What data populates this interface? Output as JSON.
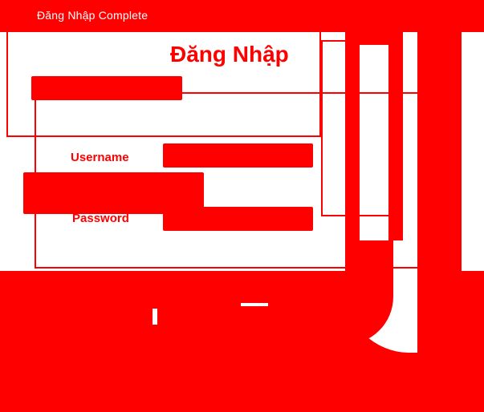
{
  "window": {
    "title": "Đăng Nhập Complete"
  },
  "form": {
    "heading": "Đăng Nhập",
    "username_label": "Username",
    "username_value": "",
    "password_label": "Password",
    "password_value": ""
  },
  "colors": {
    "accent": "#ff0000",
    "background": "#ffffff"
  }
}
